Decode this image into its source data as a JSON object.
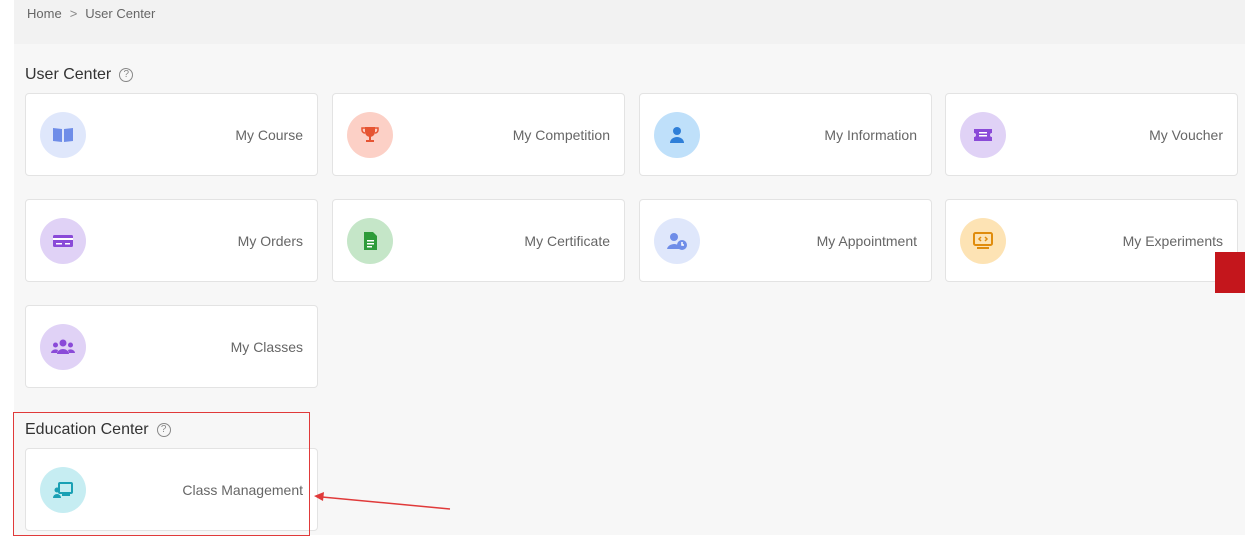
{
  "breadcrumb": {
    "home": "Home",
    "separator": ">",
    "current": "User Center"
  },
  "sections": {
    "user_center": {
      "title": "User Center",
      "help_icon": "question-circle-icon"
    },
    "education_center": {
      "title": "Education Center",
      "help_icon": "question-circle-icon"
    }
  },
  "cards": [
    {
      "label": "My Course",
      "icon": "book-icon",
      "color": "#dfe7fb"
    },
    {
      "label": "My Competition",
      "icon": "trophy-icon",
      "color": "#fcd0c6"
    },
    {
      "label": "My Information",
      "icon": "user-icon",
      "color": "#bfe0fa"
    },
    {
      "label": "My Voucher",
      "icon": "ticket-icon",
      "color": "#e0d2f6"
    },
    {
      "label": "My Orders",
      "icon": "card-icon",
      "color": "#e0d2f6"
    },
    {
      "label": "My Certificate",
      "icon": "document-icon",
      "color": "#c5e6c8"
    },
    {
      "label": "My Appointment",
      "icon": "user-clock-icon",
      "color": "#dfe7fb"
    },
    {
      "label": "My Experiments",
      "icon": "monitor-code-icon",
      "color": "#fde3b4"
    },
    {
      "label": "My Classes",
      "icon": "users-icon",
      "color": "#e0d2f6"
    }
  ],
  "education_cards": [
    {
      "label": "Class Management",
      "icon": "class-board-icon",
      "color": "#c6edf2"
    }
  ],
  "annotation": {
    "color": "#e03a3a"
  }
}
